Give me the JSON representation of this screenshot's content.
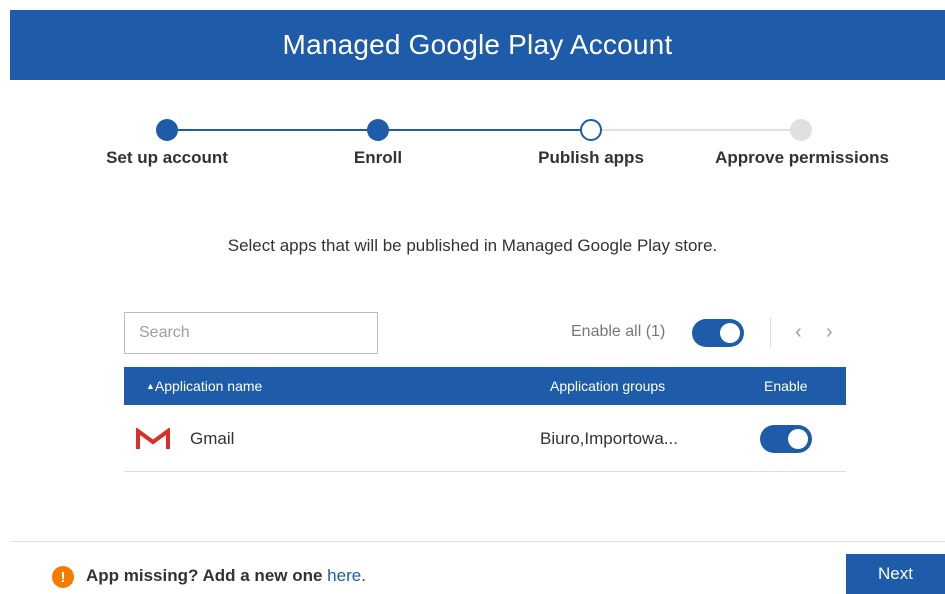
{
  "header": {
    "title": "Managed Google Play Account"
  },
  "stepper": {
    "steps": [
      {
        "label": "Set up account",
        "state": "done"
      },
      {
        "label": "Enroll",
        "state": "done"
      },
      {
        "label": "Publish apps",
        "state": "current"
      },
      {
        "label": "Approve permissions",
        "state": "todo"
      }
    ],
    "colors": {
      "done": "#1e5ba8",
      "todo": "#e0e0e0"
    }
  },
  "instruction": "Select apps that will be published in Managed Google Play store.",
  "search": {
    "placeholder": "Search",
    "value": ""
  },
  "toolbar": {
    "enable_all_label": "Enable all (1)",
    "enable_all_on": true,
    "prev_icon": "chevron-left-icon",
    "next_icon": "chevron-right-icon"
  },
  "table": {
    "columns": [
      "Application name",
      "Application groups",
      "Enable"
    ],
    "sort_icon": "sort-ascending-icon",
    "rows": [
      {
        "icon": "gmail-icon",
        "name": "Gmail",
        "groups": "Biuro,Importowa...",
        "enabled": true
      }
    ]
  },
  "footer": {
    "missing_text": "App missing? Add a new one ",
    "link_text": "here",
    "link_suffix": ".",
    "warning_icon": "exclamation-icon",
    "warning_glyph": "!",
    "next_label": "Next"
  },
  "colors": {
    "brand": "#1e5ba8",
    "warning": "#f57c00",
    "gmail_red": "#d93025"
  }
}
